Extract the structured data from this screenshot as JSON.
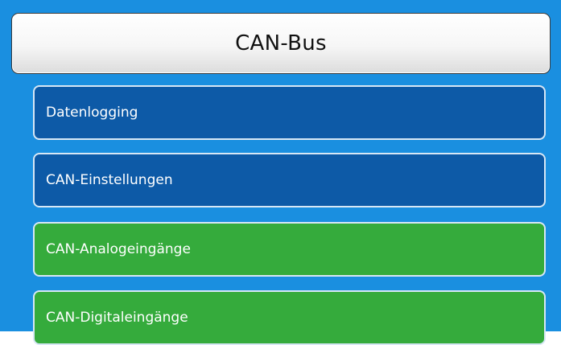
{
  "header": {
    "title": "CAN-Bus"
  },
  "menu": {
    "items": [
      {
        "label": "Datenlogging",
        "color": "#0d5aa7"
      },
      {
        "label": "CAN-Einstellungen",
        "color": "#0d5aa7"
      },
      {
        "label": "CAN-Analogeingänge",
        "color": "#35ab3c"
      },
      {
        "label": "CAN-Digitaleingänge",
        "color": "#35ab3c"
      }
    ]
  },
  "colors": {
    "background": "#1a8fe0",
    "header_border": "#3a3a3a"
  }
}
